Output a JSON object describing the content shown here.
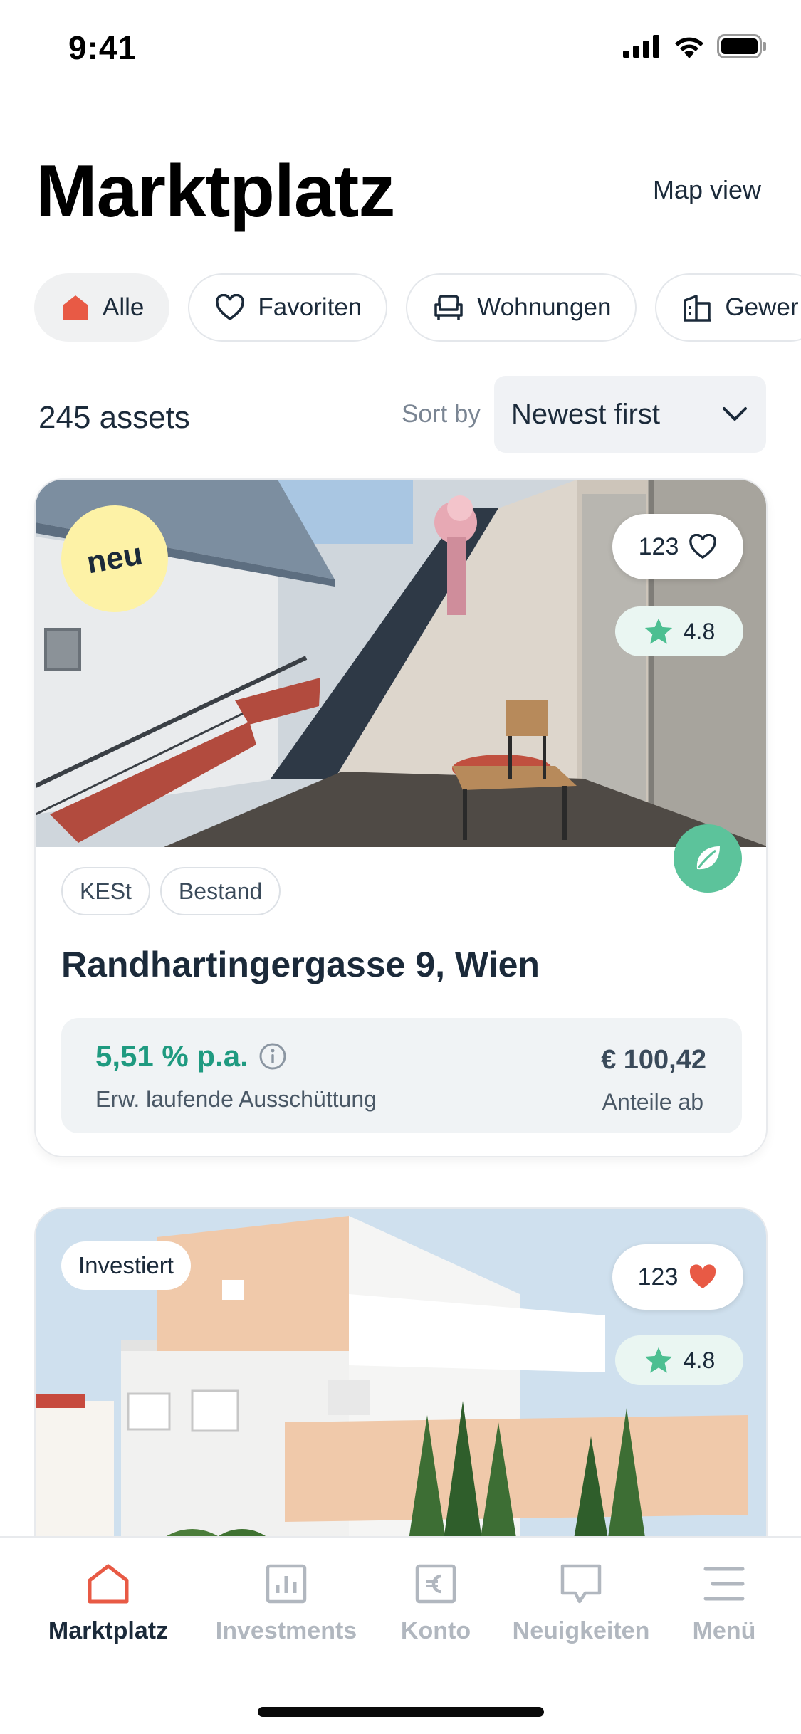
{
  "status_bar": {
    "time": "9:41"
  },
  "header": {
    "title": "Marktplatz",
    "map_view_label": "Map view"
  },
  "filters": {
    "chips": [
      {
        "label": "Alle",
        "icon": "house-icon",
        "active": true
      },
      {
        "label": "Favoriten",
        "icon": "heart-outline-icon",
        "active": false
      },
      {
        "label": "Wohnungen",
        "icon": "armchair-icon",
        "active": false
      },
      {
        "label": "Gewer",
        "icon": "commercial-building-icon",
        "active": false
      }
    ]
  },
  "listing": {
    "count_label": "245 assets",
    "sort_label": "Sort by",
    "sort_value": "Newest first"
  },
  "cards": [
    {
      "badge": "neu",
      "likes": "123",
      "liked": false,
      "rating": "4.8",
      "eco": true,
      "tags": [
        "KESt",
        "Bestand"
      ],
      "title": "Randhartingergasse 9, Wien",
      "yield": "5,51 % p.a.",
      "yield_caption": "Erw. laufende Ausschüttung",
      "price": "€ 100,42",
      "price_caption": "Anteile ab"
    },
    {
      "badge": "Investiert",
      "likes": "123",
      "liked": true,
      "rating": "4.8"
    }
  ],
  "bottom_nav": {
    "items": [
      {
        "label": "Marktplatz",
        "icon": "house-icon",
        "active": true
      },
      {
        "label": "Investments",
        "icon": "bar-chart-icon",
        "active": false
      },
      {
        "label": "Konto",
        "icon": "euro-icon",
        "active": false
      },
      {
        "label": "Neuigkeiten",
        "icon": "speech-bubble-icon",
        "active": false
      },
      {
        "label": "Menü",
        "icon": "menu-icon",
        "active": false
      }
    ]
  },
  "colors": {
    "accent": "#e85a45",
    "yield_green": "#1f9a80",
    "eco_green": "#5cc39b",
    "neu_yellow": "#fdf2a6"
  }
}
